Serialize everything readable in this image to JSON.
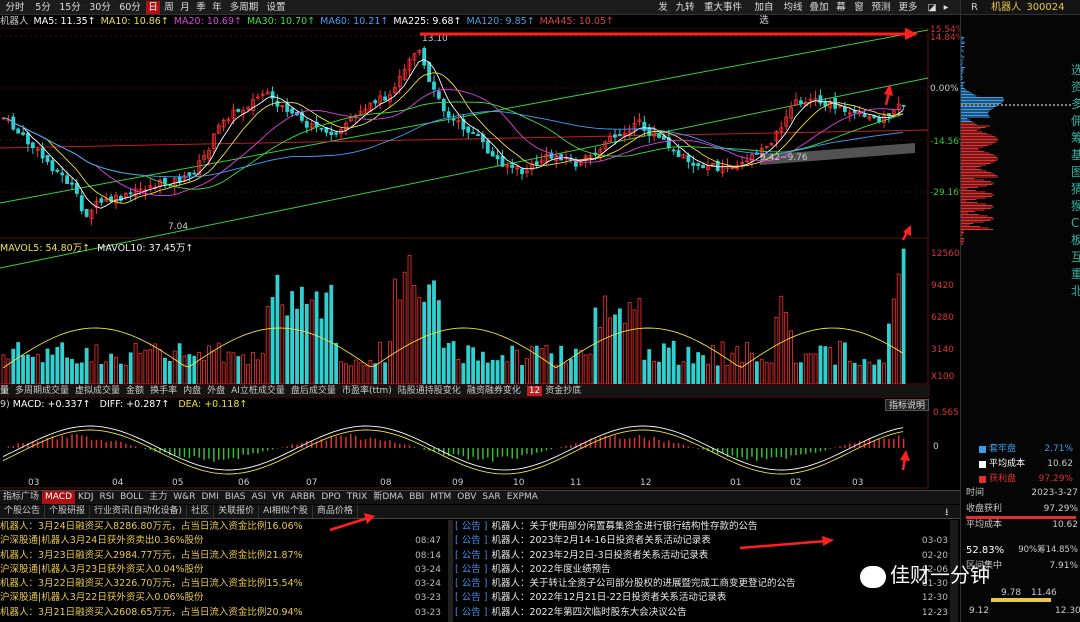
{
  "toolbar": {
    "periods": [
      "分时",
      "5分",
      "15分",
      "30分",
      "60分",
      "日",
      "周",
      "月",
      "季",
      "年",
      "多周期",
      "设置"
    ],
    "active_period": "日",
    "tools": [
      "发",
      "九转",
      "重大事件",
      "加自选",
      "均线",
      "叠加",
      "幕",
      "窗",
      "预测",
      "更多"
    ]
  },
  "stock": {
    "name": "机器人",
    "code": "300024",
    "prefix": "R"
  },
  "ma": {
    "label": "机器人",
    "items": [
      {
        "text": "MA5: 11.35↑",
        "color": "#ffffff"
      },
      {
        "text": "MA10: 10.86↑",
        "color": "#f0e040"
      },
      {
        "text": "MA20: 10.69↑",
        "color": "#e040e0"
      },
      {
        "text": "MA30: 10.70↑",
        "color": "#40e040"
      },
      {
        "text": "MA60: 10.21↑",
        "color": "#40a0ff"
      },
      {
        "text": "MA225: 9.68↑",
        "color": "#ffffff"
      },
      {
        "text": "MA120: 9.85↑",
        "color": "#40a0e0"
      },
      {
        "text": "MA445: 10.05↑",
        "color": "#e04040"
      }
    ]
  },
  "price_axis": [
    "15.54%",
    "14.84%",
    "0.00%",
    "-14.56%",
    "-29.16%"
  ],
  "price_labels": {
    "high": "13.10",
    "low": "7.04",
    "mid": "9.42~9.76"
  },
  "volume": {
    "mavol5": "MAVOL5: 54.80万↑",
    "mavol10": "MAVOL10: 37.45万↑",
    "axis": [
      "12560",
      "9420",
      "6280",
      "3140",
      "X100"
    ]
  },
  "indicator_tabs": [
    "量",
    "多周期成交量",
    "虚拟成交量",
    "金额",
    "换手率",
    "内盘",
    "外盘",
    "AI立桩成交量",
    "盘后成交量",
    "市盈率(ttm)",
    "陆股通持股变化",
    "融资融券变化",
    "资金抄底"
  ],
  "indicator_badge": "12",
  "macd": {
    "params": "9)",
    "macd": "MACD: +0.337↑",
    "diff": "DIFF: +0.287↑",
    "dea": "DEA: +0.118↑",
    "button": "指标说明",
    "axis": [
      "0.565",
      "0"
    ]
  },
  "months": [
    "03",
    "04",
    "05",
    "06",
    "07",
    "08",
    "09",
    "10",
    "11",
    "12",
    "01",
    "02",
    "03"
  ],
  "bottom_tabs": [
    "指标广场",
    "MACD",
    "KDJ",
    "RSI",
    "BOLL",
    "主力",
    "W&R",
    "DMI",
    "BIAS",
    "ASI",
    "VR",
    "ARBR",
    "DPO",
    "TRIX",
    "新DMA",
    "BBI",
    "MTM",
    "OBV",
    "SAR",
    "EXPMA"
  ],
  "active_bottom_tab": "MACD",
  "news_tabs": [
    "个股公告",
    "个股研报",
    "行业资讯(自动化设备)",
    "社区",
    "关联报价",
    "AI相似个股",
    "商品价格"
  ],
  "left_news": [
    {
      "text": "机器人：3月24日融资买入8286.80万元，占当日流入资金比例16.06%",
      "date": "08:47"
    },
    {
      "text": "沪深股通|机器人3月24日获外资卖出0.36%股份",
      "date": "08:14"
    },
    {
      "text": "机器人：3月23日融资买入2984.77万元，占当日流入资金比例21.87%",
      "date": "03-24"
    },
    {
      "text": "沪深股通|机器人3月23日获外资买入0.04%股份",
      "date": "03-24"
    },
    {
      "text": "机器人：3月22日融资买入3226.70万元，占当日流入资金比例15.54%",
      "date": "03-23"
    },
    {
      "text": "沪深股通|机器人3月22日获外资买入0.06%股份",
      "date": "03-23"
    },
    {
      "text": "机器人：3月21日融资买入2608.65万元，占当日流入资金比例20.94%",
      "date": "03-22"
    }
  ],
  "right_news": [
    {
      "tag": "[ 公告 ]",
      "text": "机器人：关于使用部分闲置募集资金进行银行结构性存款的公告",
      "date": "03-03"
    },
    {
      "tag": "[ 公告 ]",
      "text": "机器人：2023年2月14-16日投资者关系活动记录表",
      "date": "02-20"
    },
    {
      "tag": "[ 公告 ]",
      "text": "机器人：2023年2月2日-3日投资者关系活动记录表",
      "date": "02-06"
    },
    {
      "tag": "[ 公告 ]",
      "text": "机器人：2022年度业绩预告",
      "date": "01-30"
    },
    {
      "tag": "[ 公告 ]",
      "text": "机器人：关于转让全资子公司部分股权的进展暨完成工商变更登记的公告",
      "date": "12-30"
    },
    {
      "tag": "[ 公告 ]",
      "text": "机器人：2022年12月21日-22日投资者关系活动记录表",
      "date": "12-23"
    },
    {
      "tag": "[ 公告 ]",
      "text": "机器人：2022年第四次临时股东大会决议公告",
      "date": "12-23"
    }
  ],
  "sidebar": {
    "legend": [
      {
        "label": "套牢盘",
        "value": "2.71%",
        "color": "#3a9ee8"
      },
      {
        "label": "平均成本",
        "value": "10.62",
        "color": "#ffffff"
      },
      {
        "label": "获利盘",
        "value": "97.29%",
        "color": "#e03030"
      }
    ],
    "time_label": "时间",
    "time_value": "2023-3-27",
    "profit_label": "收盘获利",
    "profit_value": "97.29%",
    "cost_label": "平均成本",
    "cost_value": "10.62",
    "conc_value": "52.83%",
    "conc_label": "90%筹14.85%",
    "range_label": "区间集中",
    "range_value": "7.91%",
    "bottom_left": "9.12",
    "bottom_mid": "9.78",
    "bottom_mid2": "11.46",
    "bottom_right": "12.30",
    "side_chars": [
      "选",
      "资",
      "多",
      "佣",
      "筹",
      "基",
      "图",
      "猜",
      "猴",
      "C",
      "板",
      "互",
      "重",
      "北"
    ]
  },
  "watermark": "佳财一分钟"
}
